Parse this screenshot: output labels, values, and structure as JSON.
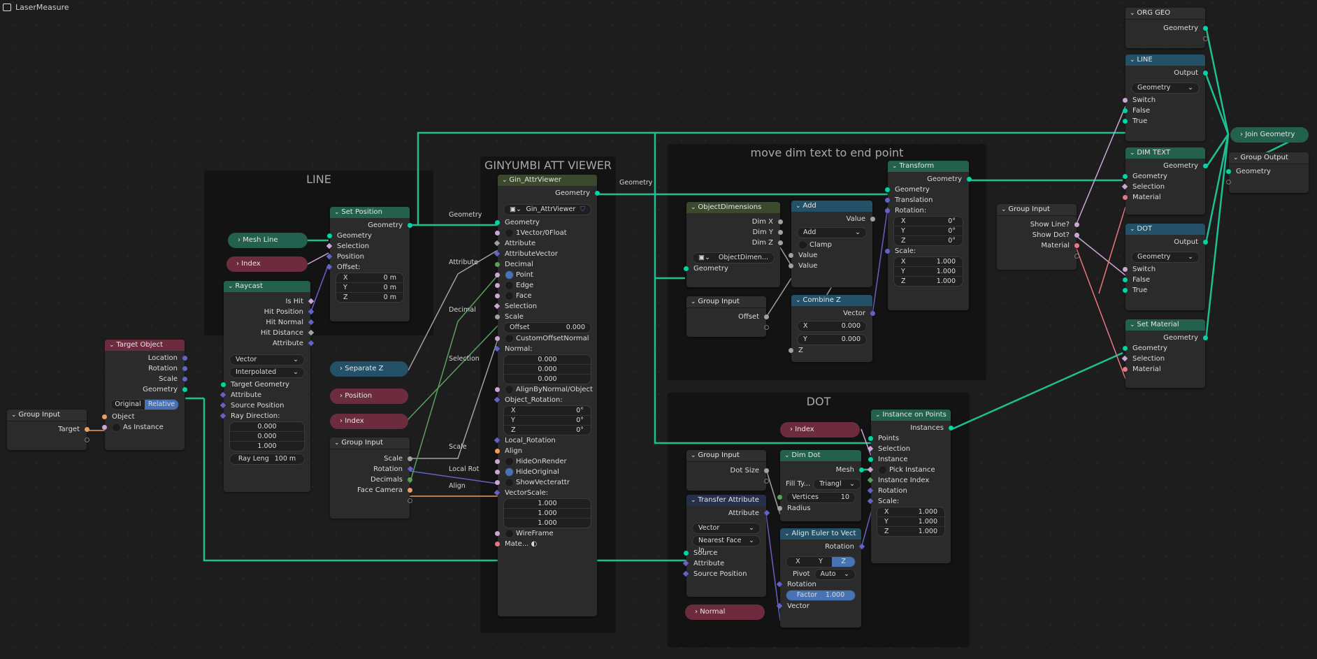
{
  "app": {
    "title": "LaserMeasure",
    "icon": "node-tree-icon"
  },
  "frames": {
    "line": "LINE",
    "viewer": "GINYUMBI ATT VIEWER",
    "dimtext": "move dim text to end point",
    "dot": "DOT"
  },
  "reroute_labels": {
    "geom1": "Geometry",
    "geom2": "Geometry",
    "attribute": "Attribute",
    "decimal": "Decimal",
    "selection": "Selection",
    "scale": "Scale",
    "local_rot": "Local Rot",
    "align": "Align"
  },
  "group_input_main": {
    "title": "Group Input",
    "outputs": [
      "Target"
    ]
  },
  "target_object": {
    "title": "Target Object",
    "outputs": [
      "Location",
      "Rotation",
      "Scale",
      "Geometry"
    ],
    "toggle": [
      "Original",
      "Relative"
    ],
    "active_toggle": "Relative",
    "inputs": [
      "Object",
      "As Instance"
    ]
  },
  "raycast": {
    "title": "Raycast",
    "outputs": [
      "Is Hit",
      "Hit Position",
      "Hit Normal",
      "Hit Distance",
      "Attribute"
    ],
    "data_type": "Vector",
    "mapping": "Interpolated",
    "inputs": [
      "Target Geometry",
      "Attribute",
      "Source Position",
      "Ray Direction:"
    ],
    "ray_direction": [
      "0.000",
      "0.000",
      "1.000"
    ],
    "ray_length_label": "Ray Leng",
    "ray_length": "100 m"
  },
  "mesh_line": {
    "title": "Mesh Line"
  },
  "index1": {
    "title": "Index"
  },
  "set_position": {
    "title": "Set Position",
    "output": "Geometry",
    "inputs": [
      "Geometry",
      "Selection",
      "Position",
      "Offset:"
    ],
    "offset": [
      {
        "axis": "X",
        "value": "0 m"
      },
      {
        "axis": "Y",
        "value": "0 m"
      },
      {
        "axis": "Z",
        "value": "0 m"
      }
    ]
  },
  "separate_z": {
    "title": "Separate Z"
  },
  "position": {
    "title": "Position"
  },
  "index2": {
    "title": "Index"
  },
  "group_input_viewer": {
    "title": "Group Input",
    "outputs": [
      "Scale",
      "Rotation",
      "Decimals",
      "Face Camera"
    ]
  },
  "attr_viewer": {
    "title": "Gin_AttrViewer",
    "output": "Geometry",
    "group_name": "Gin_AttrViewer",
    "inputs": [
      "Geometry",
      "1Vector/0Float",
      "Attribute",
      "AttributeVector",
      "Decimal",
      "Point",
      "Edge",
      "Face",
      "Selection",
      "Scale"
    ],
    "offset_label": "Offset",
    "offset_value": "0.000",
    "custom_offset": "CustomOffsetNormal",
    "normal_label": "Normal:",
    "normal": [
      "0.000",
      "0.000",
      "0.000"
    ],
    "align_by": "AlignByNormal/Object",
    "obj_rot_label": "Object_Rotation:",
    "obj_rot": [
      {
        "axis": "X",
        "value": "0°"
      },
      {
        "axis": "Y",
        "value": "0°"
      },
      {
        "axis": "Z",
        "value": "0°"
      }
    ],
    "local_rotation": "Local_Rotation",
    "align": "Align",
    "hide_on_render": "HideOnRender",
    "hide_original": "HideOriginal",
    "show_vec": "ShowVecterattr",
    "vector_scale_label": "VectorScale:",
    "vector_scale": [
      "1.000",
      "1.000",
      "1.000"
    ],
    "wireframe": "WireFrame",
    "material": "Mate..."
  },
  "object_dimensions": {
    "title": "ObjectDimensions",
    "outputs": [
      "Dim X",
      "Dim Y",
      "Dim Z"
    ],
    "group_name": "ObjectDimen...",
    "input": "Geometry"
  },
  "group_input_offset": {
    "title": "Group Input",
    "outputs": [
      "Offset"
    ]
  },
  "add_node": {
    "title": "Add",
    "output": "Value",
    "operation": "Add",
    "clamp": "Clamp",
    "inputs": [
      "Value",
      "Value"
    ]
  },
  "combine_z": {
    "title": "Combine Z",
    "output": "Vector",
    "x_label": "X",
    "x": "0.000",
    "y_label": "Y",
    "y": "0.000",
    "z_label": "Z"
  },
  "transform": {
    "title": "Transform",
    "output": "Geometry",
    "inputs": [
      "Geometry",
      "Translation",
      "Rotation:",
      "Scale:"
    ],
    "rotation": [
      {
        "axis": "X",
        "value": "0°"
      },
      {
        "axis": "Y",
        "value": "0°"
      },
      {
        "axis": "Z",
        "value": "0°"
      }
    ],
    "scale": [
      {
        "axis": "X",
        "value": "1.000"
      },
      {
        "axis": "Y",
        "value": "1.000"
      },
      {
        "axis": "Z",
        "value": "1.000"
      }
    ]
  },
  "index3": {
    "title": "Index"
  },
  "group_input_dot": {
    "title": "Group Input",
    "outputs": [
      "Dot Size"
    ]
  },
  "dim_dot": {
    "title": "Dim Dot",
    "output": "Mesh",
    "fill_label": "Fill Ty...",
    "fill_value": "Triangl",
    "vertices_label": "Vertices",
    "vertices": "10",
    "radius": "Radius"
  },
  "transfer_attribute": {
    "title": "Transfer Attribute",
    "output": "Attribute",
    "data_type": "Vector",
    "mapping": "Nearest Face In...",
    "inputs": [
      "Source",
      "Attribute",
      "Source Position"
    ]
  },
  "normal": {
    "title": "Normal"
  },
  "align_euler": {
    "title": "Align Euler to Vect",
    "output": "Rotation",
    "axes": [
      "X",
      "Y",
      "Z"
    ],
    "active_axis": "Z",
    "pivot_label": "Pivot",
    "pivot": "Auto",
    "inputs": [
      "Rotation",
      "Vector"
    ],
    "factor_label": "Factor",
    "factor": "1.000"
  },
  "instance_on_points": {
    "title": "Instance on Points",
    "output": "Instances",
    "inputs": [
      "Points",
      "Selection",
      "Instance",
      "Pick Instance",
      "Instance Index",
      "Rotation",
      "Scale:"
    ],
    "scale": [
      {
        "axis": "X",
        "value": "1.000"
      },
      {
        "axis": "Y",
        "value": "1.000"
      },
      {
        "axis": "Z",
        "value": "1.000"
      }
    ]
  },
  "group_input_switch": {
    "title": "Group Input",
    "outputs": [
      "Show Line?",
      "Show Dot?",
      "Material"
    ]
  },
  "org_geo": {
    "title": "ORG GEO",
    "output": "Geometry"
  },
  "switch_line": {
    "title": "LINE",
    "output": "Output",
    "type": "Geometry",
    "inputs": [
      "Switch",
      "False",
      "True"
    ]
  },
  "dim_text": {
    "title": "DIM TEXT",
    "output": "Geometry",
    "inputs": [
      "Geometry",
      "Selection",
      "Material"
    ]
  },
  "switch_dot": {
    "title": "DOT",
    "output": "Output",
    "type": "Geometry",
    "inputs": [
      "Switch",
      "False",
      "True"
    ]
  },
  "set_material": {
    "title": "Set Material",
    "output": "Geometry",
    "inputs": [
      "Geometry",
      "Selection",
      "Material"
    ]
  },
  "join_geometry": {
    "title": "Join Geometry"
  },
  "group_output": {
    "title": "Group Output",
    "inputs": [
      "Geometry"
    ]
  }
}
